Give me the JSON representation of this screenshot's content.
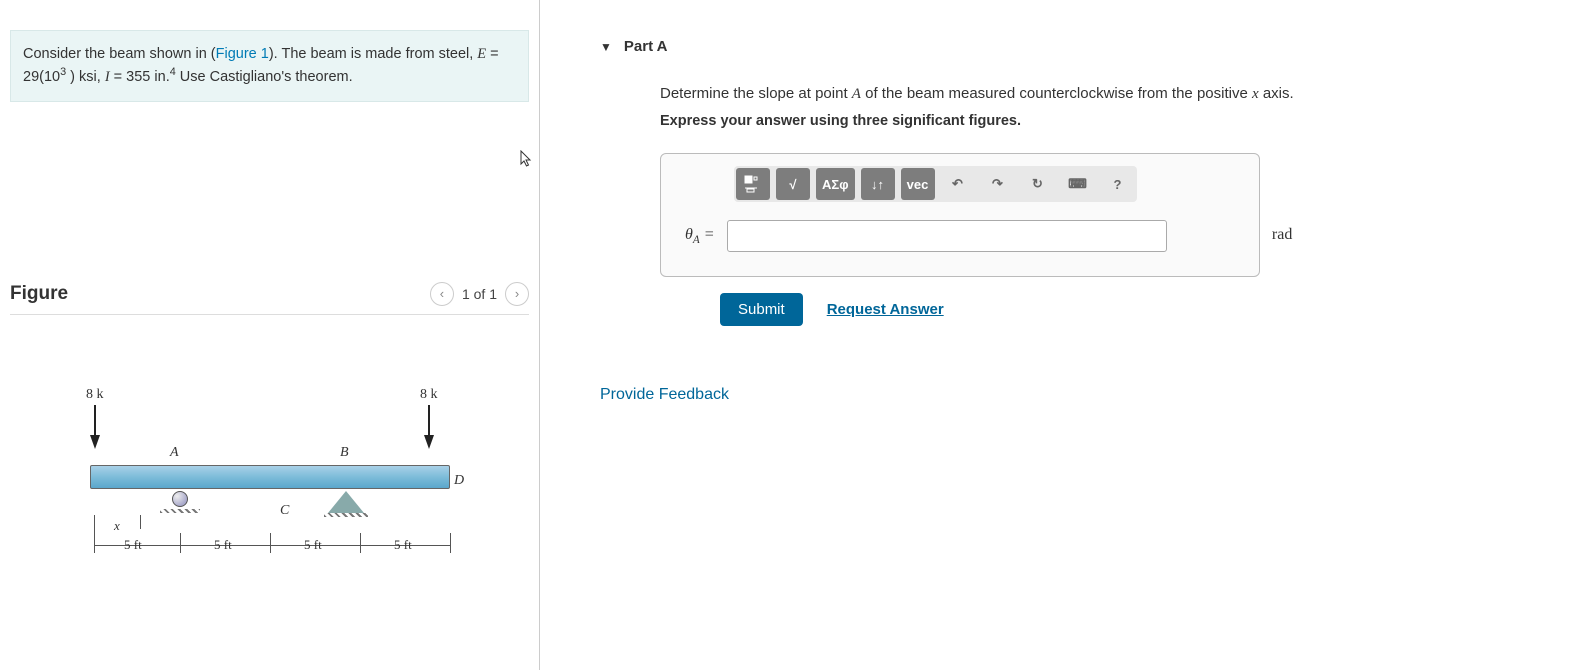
{
  "problem": {
    "text_prefix": "Consider the beam shown in (",
    "figure_link": "Figure 1",
    "text_suffix": "). The beam is made from steel, ",
    "modulus_symbol": "E",
    "modulus_equals": " = 29(10",
    "modulus_exp": "3",
    "modulus_unit_suffix": " ) ksi, ",
    "inertia_symbol": "I",
    "inertia_value": " = 355  in.",
    "inertia_exp": "4",
    "theorem": " Use Castigliano's theorem."
  },
  "figure": {
    "title": "Figure",
    "counter": "1 of 1",
    "load_left": "8 k",
    "load_right": "8 k",
    "pointA": "A",
    "pointB": "B",
    "pointC": "C",
    "pointD": "D",
    "dim_x": "x",
    "dim1": "5 ft",
    "dim2": "5 ft",
    "dim3": "5 ft",
    "dim4": "5 ft"
  },
  "partA": {
    "label": "Part A",
    "instr_prefix": "Determine the slope at point ",
    "instr_point": "A",
    "instr_mid": " of the beam measured counterclockwise from the positive ",
    "instr_axis": "x",
    "instr_suffix": " axis.",
    "instr2": "Express your answer using three significant figures.",
    "theta_sym": "θ",
    "theta_sub": "A",
    "equals": "=",
    "unit": "rad",
    "submit": "Submit",
    "request": "Request Answer",
    "toolbar": {
      "templates_icon": "templates-icon",
      "sqrt": "√",
      "greek": "ΑΣφ",
      "subscript": "↓↑",
      "vec": "vec",
      "undo": "↶",
      "redo": "↷",
      "reset": "↻",
      "keyboard": "⌨",
      "help": "?"
    }
  },
  "feedback": "Provide Feedback"
}
